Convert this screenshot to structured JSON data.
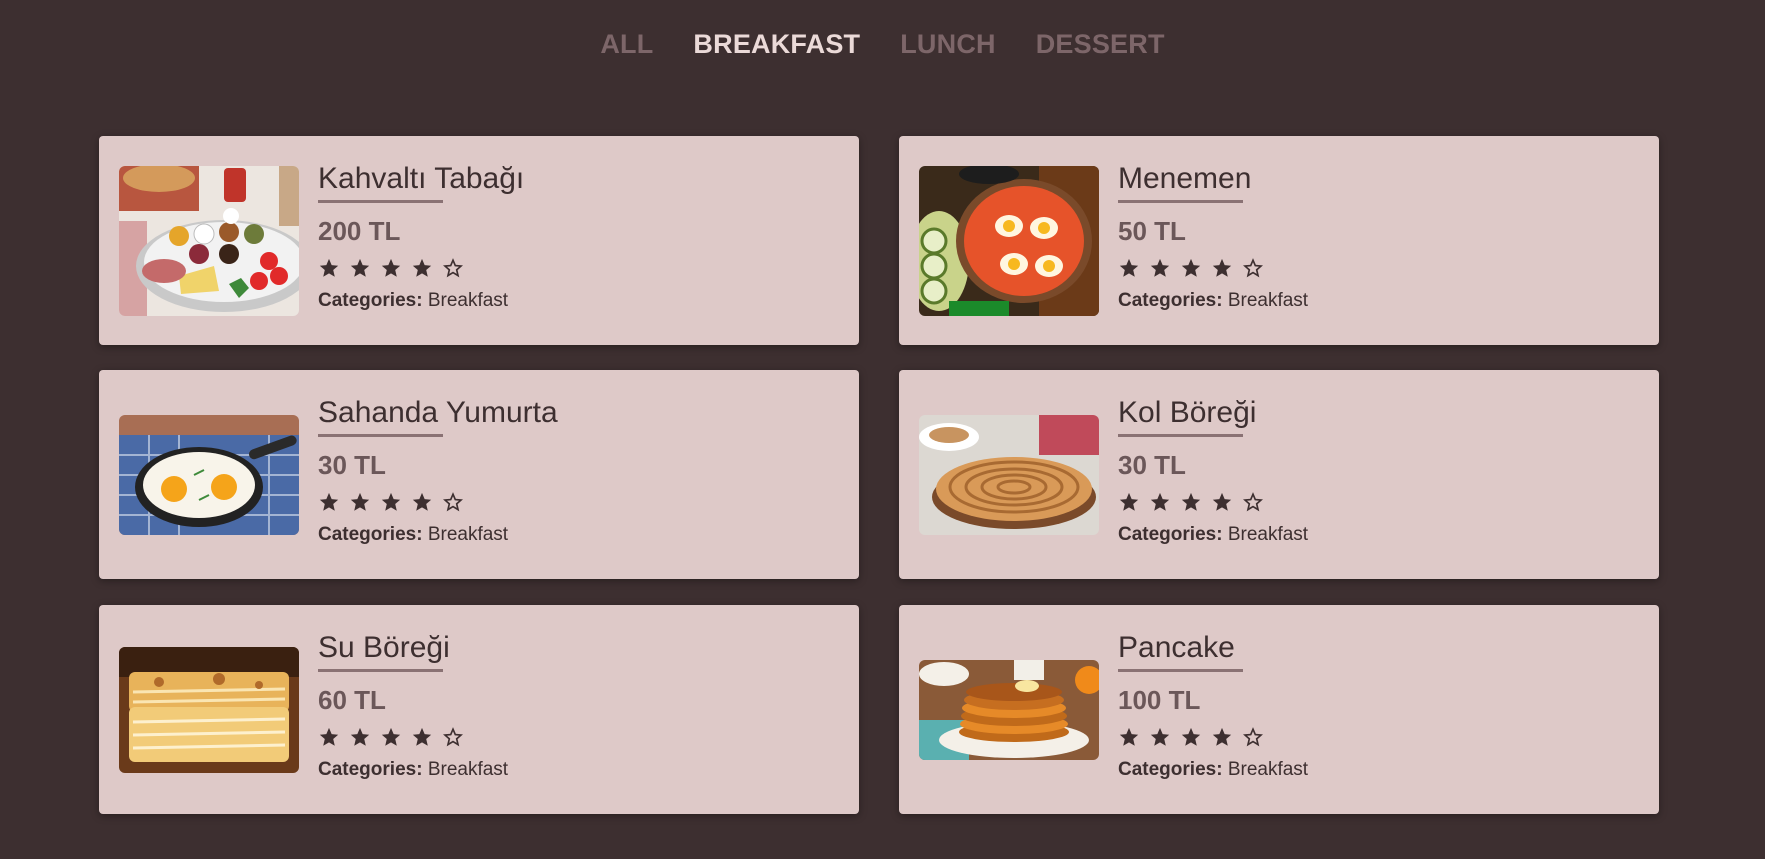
{
  "nav": {
    "tabs": [
      {
        "label": "ALL",
        "active": false
      },
      {
        "label": "BREAKFAST",
        "active": true
      },
      {
        "label": "LUNCH",
        "active": false
      },
      {
        "label": "DESSERT",
        "active": false
      }
    ]
  },
  "colors": {
    "background": "#3d2f30",
    "card": "#dec9c8",
    "active_tab": "#ebdad8",
    "inactive_tab": "#7d6669",
    "text_dark": "#3d2f30",
    "price": "#6b5759"
  },
  "menu": {
    "categories_label": "Categories:",
    "items": [
      {
        "title": "Kahvaltı Tabağı",
        "price": "200 TL",
        "rating": 4,
        "rating_max": 5,
        "category": "Breakfast",
        "image": "breakfast-plate-photo"
      },
      {
        "title": "Menemen",
        "price": "50 TL",
        "rating": 4,
        "rating_max": 5,
        "category": "Breakfast",
        "image": "menemen-pan-photo"
      },
      {
        "title": "Sahanda Yumurta",
        "price": "30 TL",
        "rating": 4,
        "rating_max": 5,
        "category": "Breakfast",
        "image": "fried-eggs-pan-photo"
      },
      {
        "title": "Kol Böreği",
        "price": "30 TL",
        "rating": 4,
        "rating_max": 5,
        "category": "Breakfast",
        "image": "spiral-borek-photo"
      },
      {
        "title": "Su Böreği",
        "price": "60 TL",
        "rating": 4,
        "rating_max": 5,
        "category": "Breakfast",
        "image": "layered-borek-photo"
      },
      {
        "title": "Pancake",
        "price": "100 TL",
        "rating": 4,
        "rating_max": 5,
        "category": "Breakfast",
        "image": "pancake-stack-photo"
      }
    ]
  }
}
